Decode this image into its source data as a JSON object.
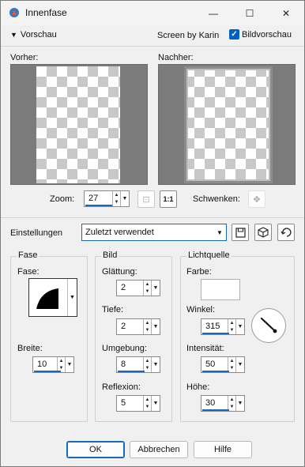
{
  "window": {
    "title": "Innenfase",
    "minimize": "—",
    "maximize": "☐",
    "close": "✕"
  },
  "preview": {
    "toggle_label": "Vorschau",
    "screen_by": "Screen by Karin",
    "bildvorschau_label": "Bildvorschau",
    "bildvorschau_checked": true,
    "vorher_label": "Vorher:",
    "nachher_label": "Nachher:",
    "zoom_label": "Zoom:",
    "zoom_value": "27",
    "schwenken_label": "Schwenken:"
  },
  "settings": {
    "label": "Einstellungen",
    "preset_value": "Zuletzt verwendet"
  },
  "fase": {
    "title": "Fase",
    "fase_label": "Fase:",
    "breite_label": "Breite:",
    "breite_value": "10"
  },
  "bild": {
    "title": "Bild",
    "glaettung_label": "Glättung:",
    "glaettung_value": "2",
    "tiefe_label": "Tiefe:",
    "tiefe_value": "2",
    "umgebung_label": "Umgebung:",
    "umgebung_value": "8",
    "reflexion_label": "Reflexion:",
    "reflexion_value": "5"
  },
  "lichtquelle": {
    "title": "Lichtquelle",
    "farbe_label": "Farbe:",
    "farbe_color": "#ffffff",
    "winkel_label": "Winkel:",
    "winkel_value": "315",
    "intensitaet_label": "Intensität:",
    "intensitaet_value": "50",
    "hoehe_label": "Höhe:",
    "hoehe_value": "30"
  },
  "buttons": {
    "ok": "OK",
    "abbrechen": "Abbrechen",
    "hilfe": "Hilfe"
  },
  "colors": {
    "accent": "#1a68b8",
    "pane_bg": "#7b7b7b"
  }
}
